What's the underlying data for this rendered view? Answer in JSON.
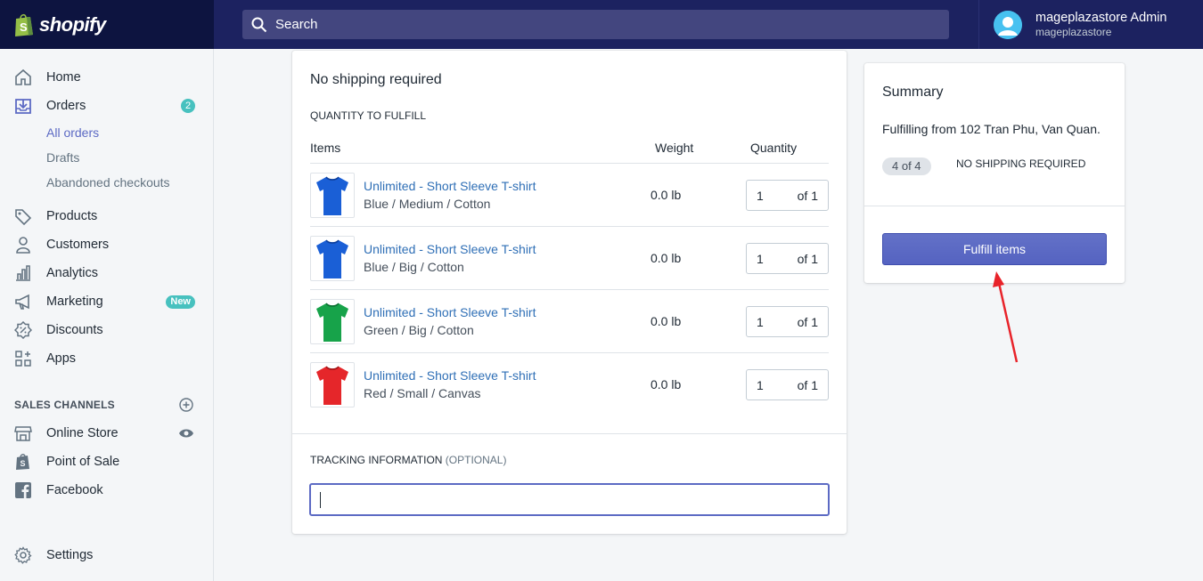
{
  "brand": {
    "name": "shopify"
  },
  "search": {
    "placeholder": "Search"
  },
  "user": {
    "name": "mageplazastore Admin",
    "store": "mageplazastore"
  },
  "sidebar": {
    "items": [
      {
        "label": "Home",
        "icon": "home-icon"
      },
      {
        "label": "Orders",
        "icon": "orders-icon",
        "badge": "2"
      },
      {
        "label": "Products",
        "icon": "tag-icon"
      },
      {
        "label": "Customers",
        "icon": "person-icon"
      },
      {
        "label": "Analytics",
        "icon": "bar-chart-icon"
      },
      {
        "label": "Marketing",
        "icon": "megaphone-icon",
        "badge": "New"
      },
      {
        "label": "Discounts",
        "icon": "discount-icon"
      },
      {
        "label": "Apps",
        "icon": "apps-icon"
      }
    ],
    "order_subitems": [
      {
        "label": "All orders",
        "active": true
      },
      {
        "label": "Drafts"
      },
      {
        "label": "Abandoned checkouts"
      }
    ],
    "sales_channels_heading": "SALES CHANNELS",
    "channels": [
      {
        "label": "Online Store",
        "icon": "store-icon"
      },
      {
        "label": "Point of Sale",
        "icon": "pos-bag-icon"
      },
      {
        "label": "Facebook",
        "icon": "facebook-icon"
      }
    ],
    "settings": {
      "label": "Settings",
      "icon": "gear-icon"
    }
  },
  "fulfill": {
    "title": "No shipping required",
    "quantity_heading": "QUANTITY TO FULFILL",
    "columns": {
      "items": "Items",
      "weight": "Weight",
      "quantity": "Quantity"
    },
    "rows": [
      {
        "product": "Unlimited - Short Sleeve T-shirt",
        "variant": "Blue / Medium / Cotton",
        "weight": "0.0 lb",
        "qty": "1",
        "of": "of 1",
        "color": "#1a5fd6"
      },
      {
        "product": "Unlimited - Short Sleeve T-shirt",
        "variant": "Blue / Big / Cotton",
        "weight": "0.0 lb",
        "qty": "1",
        "of": "of 1",
        "color": "#1a5fd6"
      },
      {
        "product": "Unlimited - Short Sleeve T-shirt",
        "variant": "Green / Big / Cotton",
        "weight": "0.0 lb",
        "qty": "1",
        "of": "of 1",
        "color": "#17a34a"
      },
      {
        "product": "Unlimited - Short Sleeve T-shirt",
        "variant": "Red / Small / Canvas",
        "weight": "0.0 lb",
        "qty": "1",
        "of": "of 1",
        "color": "#e5262a"
      }
    ],
    "tracking_label": "TRACKING INFORMATION",
    "tracking_optional": "(OPTIONAL)",
    "tracking_value": ""
  },
  "summary": {
    "title": "Summary",
    "from": "Fulfilling from 102 Tran Phu, Van Quan.",
    "count": "4 of 4",
    "status": "NO SHIPPING REQUIRED",
    "button": "Fulfill items"
  },
  "colors": {
    "accent": "#5c6ac4",
    "topbar": "#1c2260",
    "link": "#2f6fb6",
    "badge": "#47c1bf",
    "annotation": "#e8232a"
  }
}
